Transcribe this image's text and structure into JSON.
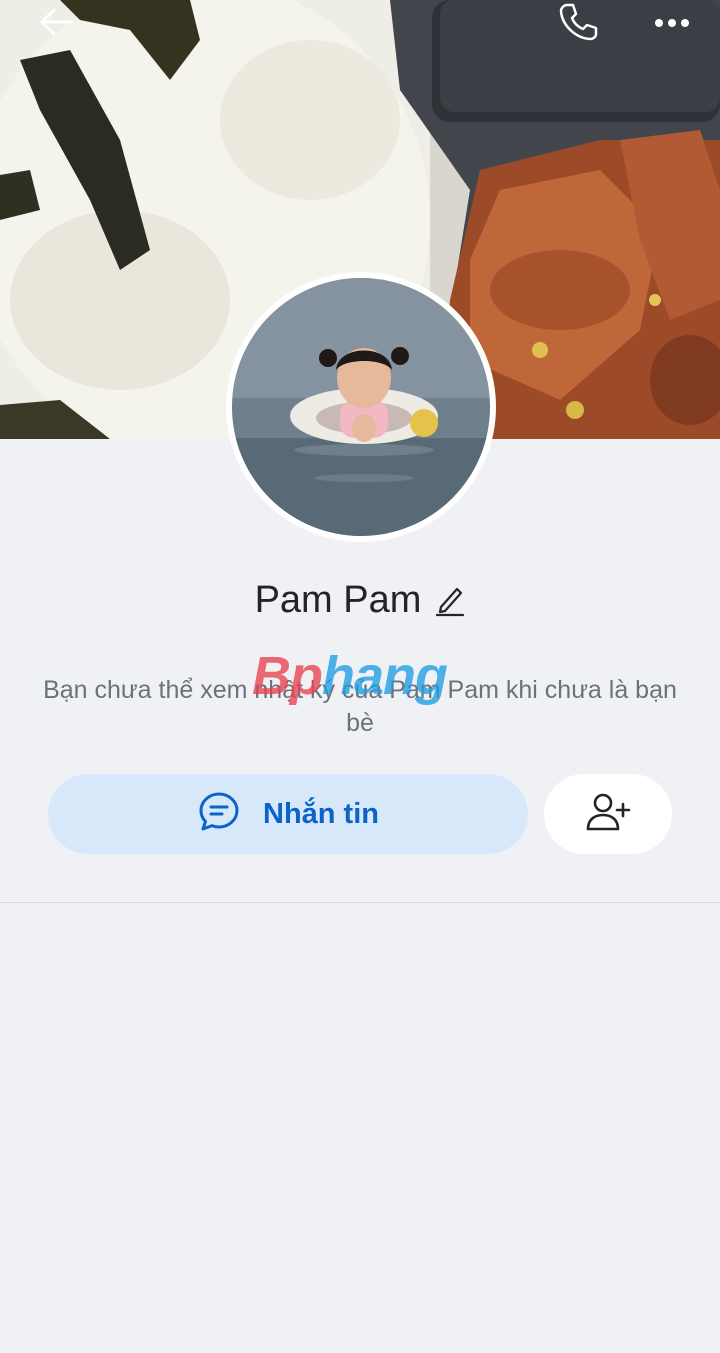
{
  "header": {
    "back_icon": "back-arrow-icon",
    "call_icon": "phone-icon",
    "more_icon": "more-dots-icon"
  },
  "profile": {
    "name": "Pam Pam",
    "edit_icon": "pencil-icon"
  },
  "diary_notice": "Bạn chưa thể xem nhật ký của Pam Pam khi chưa là bạn bè",
  "watermark": {
    "part1": "Bp",
    "part2": "hang"
  },
  "actions": {
    "message_label": "Nhắn tin",
    "message_icon": "chat-bubble-icon",
    "add_friend_icon": "add-friend-icon"
  },
  "colors": {
    "accent": "#0b63c9",
    "message_button_bg": "#d8e8fb",
    "page_bg": "#eff1f5"
  }
}
